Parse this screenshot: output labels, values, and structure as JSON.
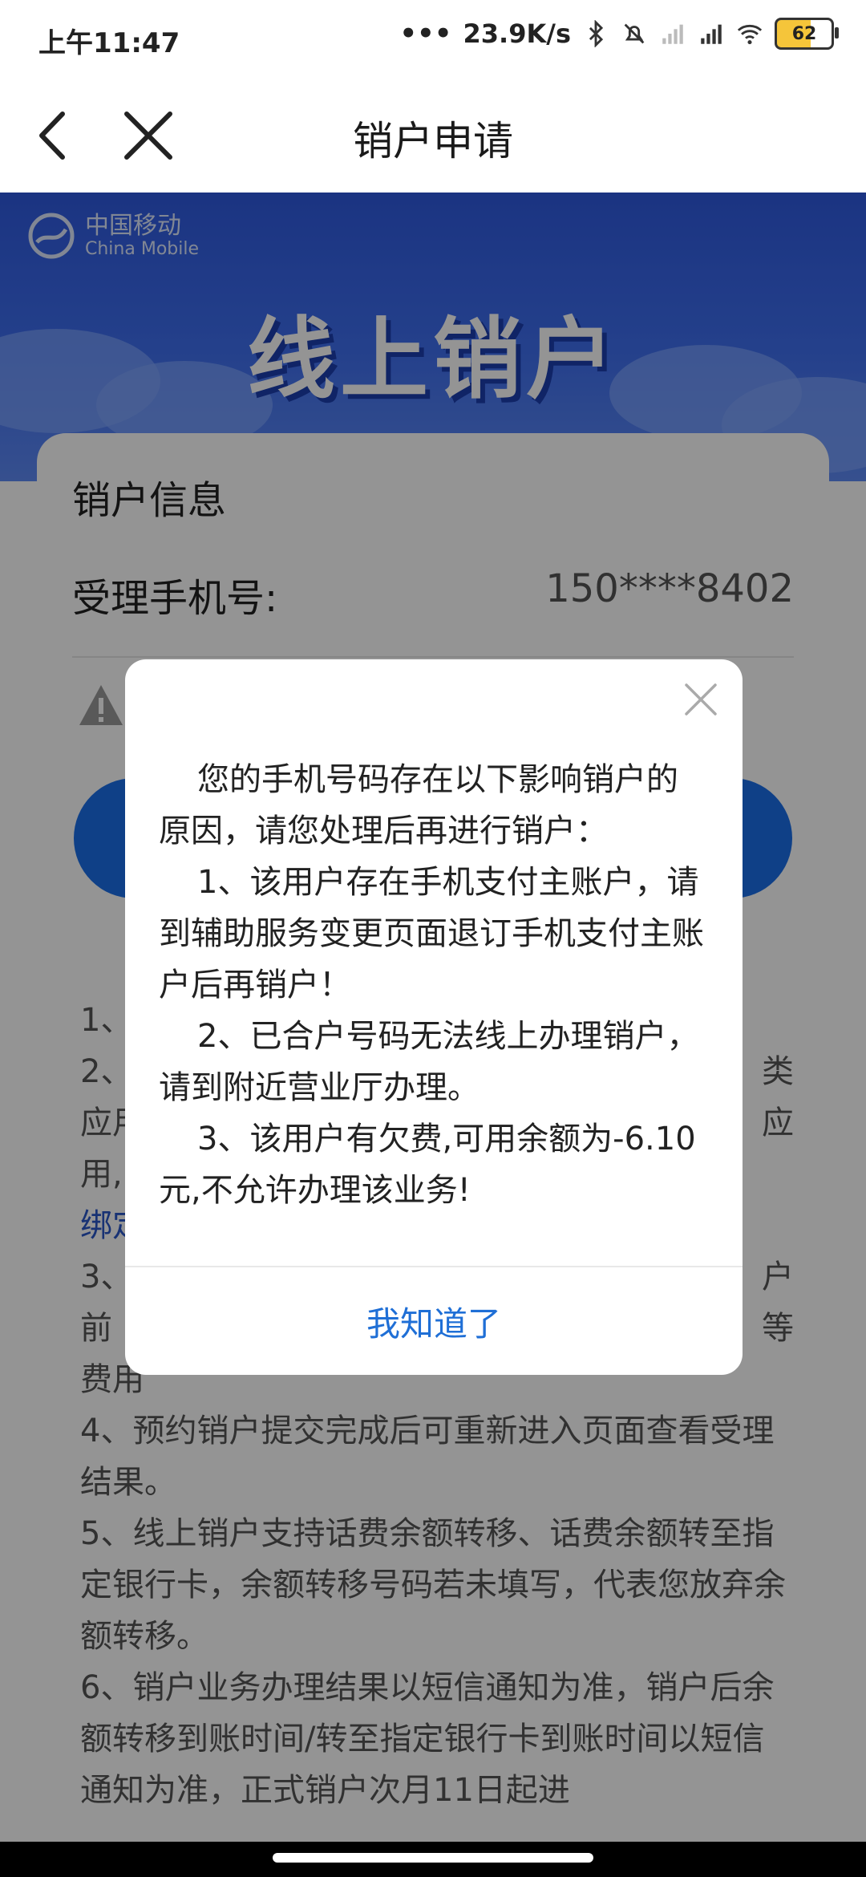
{
  "status_bar": {
    "time": "上午11:47",
    "net_speed": "23.9K/s",
    "battery": "62"
  },
  "header": {
    "title": "销户申请"
  },
  "banner": {
    "logo_cn": "中国移动",
    "logo_en": "China Mobile",
    "title": "线上销户"
  },
  "card": {
    "section_title": "销户信息",
    "phone_label": "受理手机号:",
    "phone_value": "150****8402"
  },
  "notes": {
    "lines": [
      "1、",
      "2、",
      "应用",
      "用,",
      "绑定",
      "3、",
      "前",
      "费用"
    ],
    "right_fragments": [
      "类",
      "应",
      "户",
      "等"
    ],
    "item4": "4、预约销户提交完成后可重新进入页面查看受理结果。",
    "item5": "5、线上销户支持话费余额转移、话费余额转至指定银行卡，余额转移号码若未填写，代表您放弃余额转移。",
    "item6": "6、销户业务办理结果以短信通知为准，销户后余额转移到账时间/转至指定银行卡到账时间以短信通知为准，正式销户次月11日起进"
  },
  "dialog": {
    "intro": "您的手机号码存在以下影响销户的原因，请您处理后再进行销户：",
    "reason1": "1、该用户存在手机支付主账户，请到辅助服务变更页面退订手机支付主账户后再销户！",
    "reason2": "2、已合户号码无法线上办理销户，请到附近营业厅办理。",
    "reason3": "3、该用户有欠费,可用余额为-6.10元,不允许办理该业务!",
    "ok_label": "我知道了"
  },
  "colors": {
    "accent": "#1a6fe8",
    "banner": "#3f6ff0",
    "dialog_button": "#1f6fd6"
  }
}
